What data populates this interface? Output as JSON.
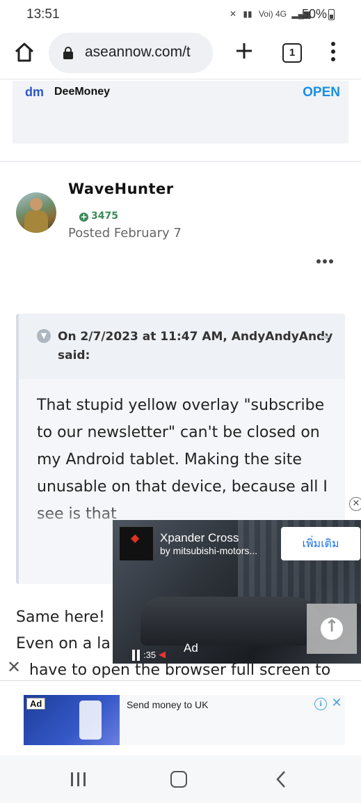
{
  "status_bar": {
    "time": "13:51",
    "icons_text": "Voi) 4G",
    "battery": "50%"
  },
  "browser": {
    "url": "aseannow.com/t",
    "tab_count": "1"
  },
  "top_ad": {
    "logo_text": "dm",
    "name": "DeeMoney",
    "cta": "OPEN"
  },
  "post": {
    "author": "WaveHunter",
    "reputation": "3475",
    "posted": "Posted February 7",
    "quote": {
      "header": "On 2/7/2023 at 11:47 AM, AndyAndyAndy said:",
      "text": "That stupid yellow overlay \"subscribe to our newsletter\" can't be closed on my Android tablet. Making the site unusable on that device, because all I see is that"
    },
    "reply_lines": [
      "Same here!",
      "Even on a la",
      "have to open the browser full screen to"
    ]
  },
  "video_ad": {
    "title": "Xpander Cross",
    "subtitle": "by mitsubishi-motors...",
    "cta": "เพิ่มเติม",
    "time": ":35",
    "label": "Ad"
  },
  "bottom_banner": {
    "ad_tag": "Ad",
    "text": "Send money to UK"
  },
  "colors": {
    "accent_link": "#1a8fe3",
    "reputation_green": "#3a8a5a",
    "quote_bg": "#f4f6f9"
  }
}
